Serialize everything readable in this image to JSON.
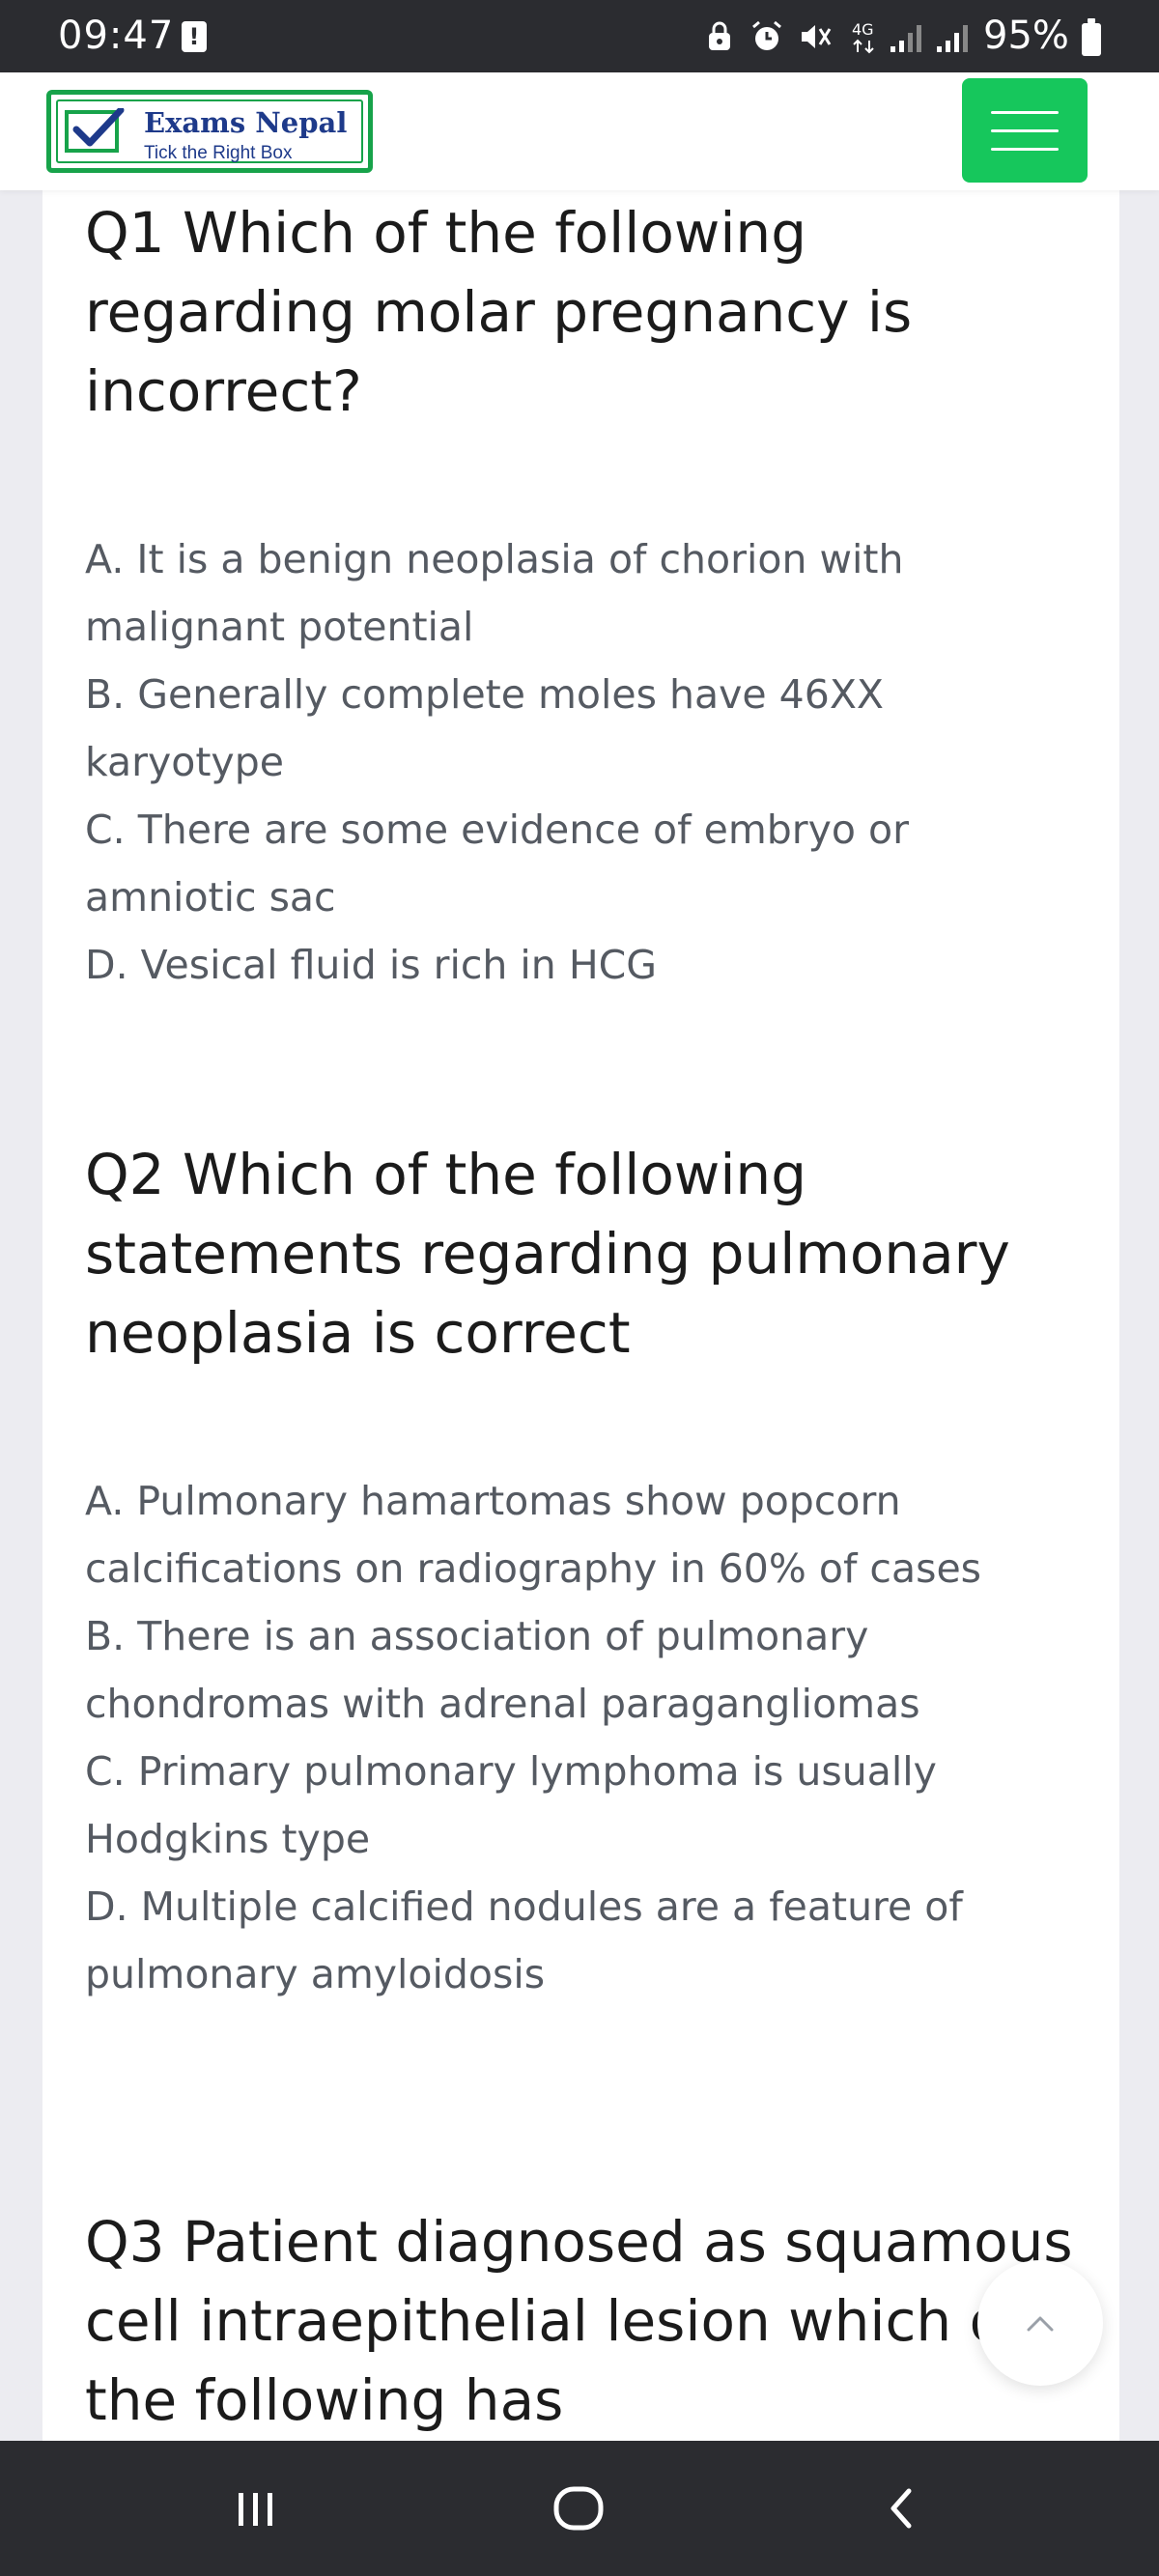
{
  "status_bar": {
    "time": "09:47",
    "notification_badge": "!",
    "network": "4G",
    "battery": "95%",
    "icons": [
      "lock-icon",
      "alarm-icon",
      "mute-icon",
      "network-4g-icon",
      "signal-icon",
      "signal-icon",
      "battery-icon"
    ]
  },
  "header": {
    "logo_title": "Exams Nepal",
    "logo_tagline": "Tick the Right Box",
    "logo_icon": "checkbox-check-icon",
    "menu_icon": "hamburger-icon",
    "colors": {
      "brand_green": "#17a34a",
      "button_green": "#16c75c",
      "logo_text": "#1e3a8a"
    }
  },
  "questions": [
    {
      "title": "Q1 Which of the following regarding molar pregnancy is incorrect?",
      "options": [
        "A. It is a benign neoplasia of chorion with malignant potential",
        "B. Generally complete moles have 46XX karyotype",
        "C. There are some evidence of embryo or amniotic sac",
        "D. Vesical fluid is rich in HCG"
      ]
    },
    {
      "title": "Q2 Which of the following statements regarding pulmonary neoplasia is correct",
      "options": [
        "A. Pulmonary hamartomas show popcorn calcifications on radiography in 60% of cases",
        "B. There is an association of pulmonary chondromas with adrenal paragangliomas",
        "C. Primary pulmonary lymphoma is usually Hodgkins type",
        "D. Multiple calcified nodules are a feature of pulmonary amyloidosis"
      ]
    },
    {
      "title": "Q3 Patient diagnosed as squamous cell intraepithelial lesion which of the following has",
      "options": []
    }
  ],
  "scroll_top": {
    "icon": "chevron-up-icon"
  },
  "nav_bar": {
    "icons": [
      "recent-apps-icon",
      "home-icon",
      "back-icon"
    ]
  }
}
